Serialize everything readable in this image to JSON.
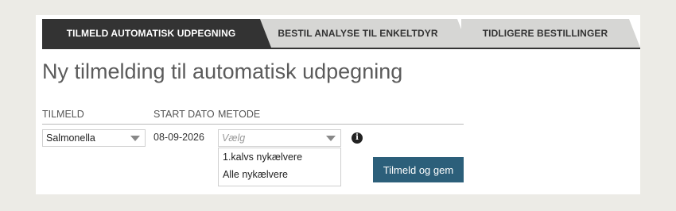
{
  "tabs": [
    {
      "label": "TILMELD AUTOMATISK UDPEGNING",
      "active": true
    },
    {
      "label": "BESTIL ANALYSE TIL ENKELTDYR",
      "active": false
    },
    {
      "label": "TIDLIGERE BESTILLINGER",
      "active": false
    }
  ],
  "page_title": "Ny tilmelding til automatisk udpegning",
  "form": {
    "headers": {
      "tilmeld": "TILMELD",
      "start_dato": "START DATO",
      "metode": "METODE"
    },
    "tilmeld_value": "Salmonella",
    "start_dato_value": "08-09-2026",
    "metode_placeholder": "Vælg",
    "metode_options": [
      "1.kalvs nykælvere",
      "Alle nykælvere"
    ],
    "submit_label": "Tilmeld og gem"
  },
  "colors": {
    "accent": "#2c5f7a",
    "active_tab": "#333333",
    "inactive_tab": "#d6d6d4"
  }
}
